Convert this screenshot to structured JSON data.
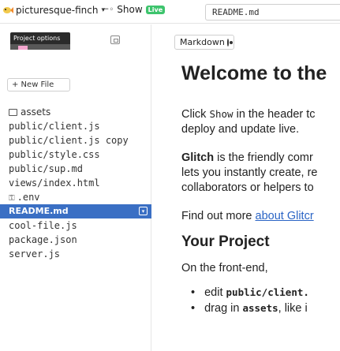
{
  "header": {
    "project_name": "picturesque-finch",
    "show_label": "Show",
    "live_badge": "Live",
    "active_tab": "README.md"
  },
  "sidebar": {
    "project_options_label": "Project options",
    "new_file_label": "+ New File",
    "files": [
      {
        "name": "assets",
        "kind": "folder"
      },
      {
        "name": "public/client.js",
        "kind": "file"
      },
      {
        "name": "public/client.js copy",
        "kind": "file"
      },
      {
        "name": "public/style.css",
        "kind": "file"
      },
      {
        "name": "public/sup.md",
        "kind": "file"
      },
      {
        "name": "views/index.html",
        "kind": "file"
      },
      {
        "name": ".env",
        "kind": "env"
      },
      {
        "name": "README.md",
        "kind": "file",
        "selected": true
      },
      {
        "name": "cool-file.js",
        "kind": "file"
      },
      {
        "name": "package.json",
        "kind": "file"
      },
      {
        "name": "server.js",
        "kind": "file"
      }
    ]
  },
  "editor": {
    "mode_label": "Markdown",
    "heading": "Welcome to the",
    "p1_a": "Click",
    "p1_code": "Show",
    "p1_b": "in the header tc",
    "p1_line2": "deploy and update live.",
    "p2_bold": "Glitch",
    "p2_rest": "is the friendly comr",
    "p2_line2": "lets you instantly create, re",
    "p2_line3": "collaborators or helpers to",
    "p3_text": "Find out more",
    "p3_link": "about Glitcr",
    "h2": "Your Project",
    "p4": "On the front-end,",
    "bullet1_a": "edit",
    "bullet1_code": "public/client.",
    "bullet2_a": "drag in",
    "bullet2_code": "assets",
    "bullet2_b": ", like i"
  },
  "colors": {
    "selected_bg": "#3a6fc4",
    "live_green": "#3ec46d",
    "link_blue": "#2a64c5"
  }
}
